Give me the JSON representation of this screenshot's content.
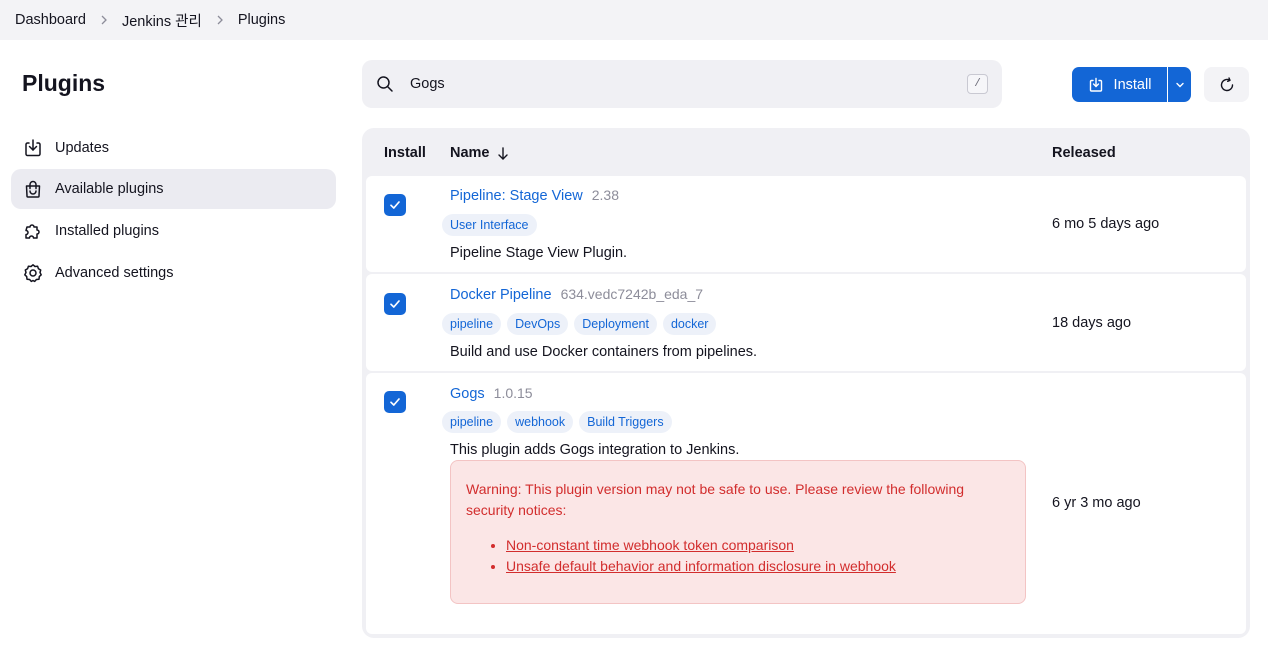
{
  "breadcrumb": [
    "Dashboard",
    "Jenkins 관리",
    "Plugins"
  ],
  "page_title": "Plugins",
  "sidebar": {
    "items": [
      {
        "label": "Updates",
        "icon": "download-icon",
        "active": false
      },
      {
        "label": "Available plugins",
        "icon": "shopping-bag-icon",
        "active": true
      },
      {
        "label": "Installed plugins",
        "icon": "puzzle-icon",
        "active": false
      },
      {
        "label": "Advanced settings",
        "icon": "gear-icon",
        "active": false
      }
    ]
  },
  "search": {
    "value": "Gogs",
    "shortcut": "/"
  },
  "toolbar": {
    "install_label": "Install"
  },
  "table": {
    "headers": {
      "install": "Install",
      "name": "Name",
      "released": "Released"
    },
    "rows": [
      {
        "name": "Pipeline: Stage View",
        "version": "2.38",
        "tags": [
          "User Interface"
        ],
        "description": "Pipeline Stage View Plugin.",
        "released": "6 mo 5 days ago",
        "checked": true
      },
      {
        "name": "Docker Pipeline",
        "version": "634.vedc7242b_eda_7",
        "tags": [
          "pipeline",
          "DevOps",
          "Deployment",
          "docker"
        ],
        "description": "Build and use Docker containers from pipelines.",
        "released": "18 days ago",
        "checked": true
      },
      {
        "name": "Gogs",
        "version": "1.0.15",
        "tags": [
          "pipeline",
          "webhook",
          "Build Triggers"
        ],
        "description": "This plugin adds Gogs integration to Jenkins.",
        "released": "6 yr 3 mo ago",
        "checked": true,
        "warning": {
          "text": "Warning: This plugin version may not be safe to use. Please review the following security notices:",
          "links": [
            "Non-constant time webhook token comparison",
            "Unsafe default behavior and information disclosure in webhook"
          ]
        }
      }
    ]
  },
  "colors": {
    "accent": "#1366d6",
    "warning_text": "#d22d2d",
    "warning_bg": "#fbe6e6"
  }
}
